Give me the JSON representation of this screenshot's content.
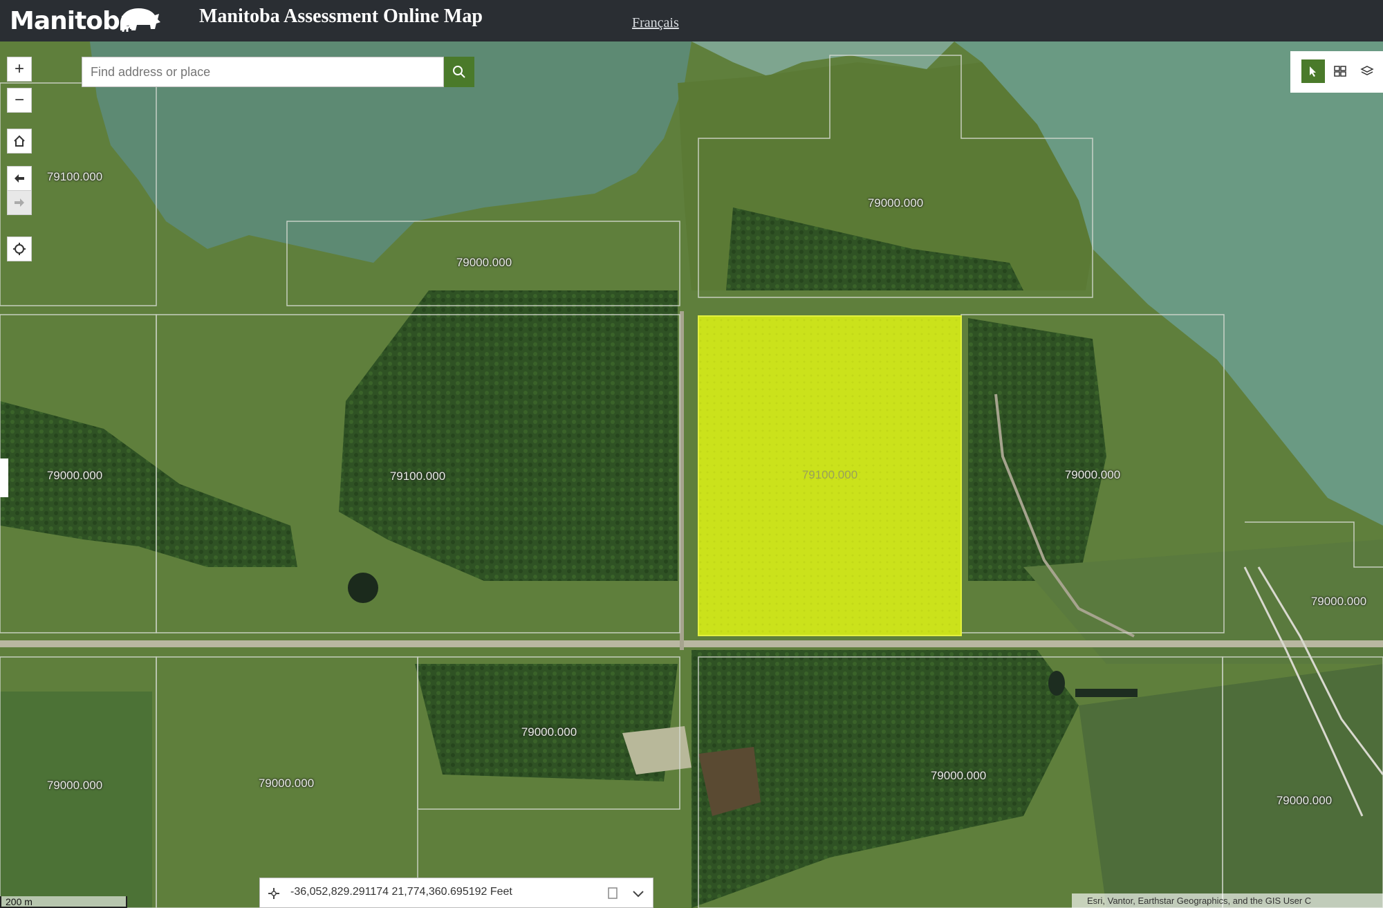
{
  "header": {
    "logo_text": "Manitoba",
    "logo_icon": "bison-icon",
    "title": "Manitoba Assessment Online Map",
    "language_link": "Français"
  },
  "search": {
    "placeholder": "Find address or place",
    "button_icon": "search-icon"
  },
  "map_controls": {
    "zoom_in": "+",
    "zoom_out": "−",
    "home_icon": "home-icon",
    "previous_extent_icon": "previous-extent-icon",
    "next_extent_icon": "next-extent-icon",
    "locate_icon": "locate-icon"
  },
  "toolbar": {
    "tools": [
      "select-tool-icon",
      "basemap-gallery-icon",
      "layer-list-icon"
    ],
    "active_tool": "select-tool-icon"
  },
  "parcels": {
    "labels": [
      "79100.000",
      "79000.000",
      "79000.000",
      "79000.000",
      "79100.000",
      "79100.000",
      "79000.000",
      "79000.000",
      "79000.000",
      "79000.000",
      "79000.000",
      "79000.000",
      "79000.000"
    ],
    "selected_label": "79100.000",
    "selected_color": "#cbe21b"
  },
  "coordinates": {
    "text": "-36,052,829.291174 21,774,360.695192 Feet"
  },
  "scalebar": {
    "text": "200 m"
  },
  "attribution": {
    "text": "Esri, Vantor, Earthstar Geographics, and the GIS User C"
  },
  "colors": {
    "header_bg": "#2a2e33",
    "accent_green": "#4a7a2a"
  }
}
